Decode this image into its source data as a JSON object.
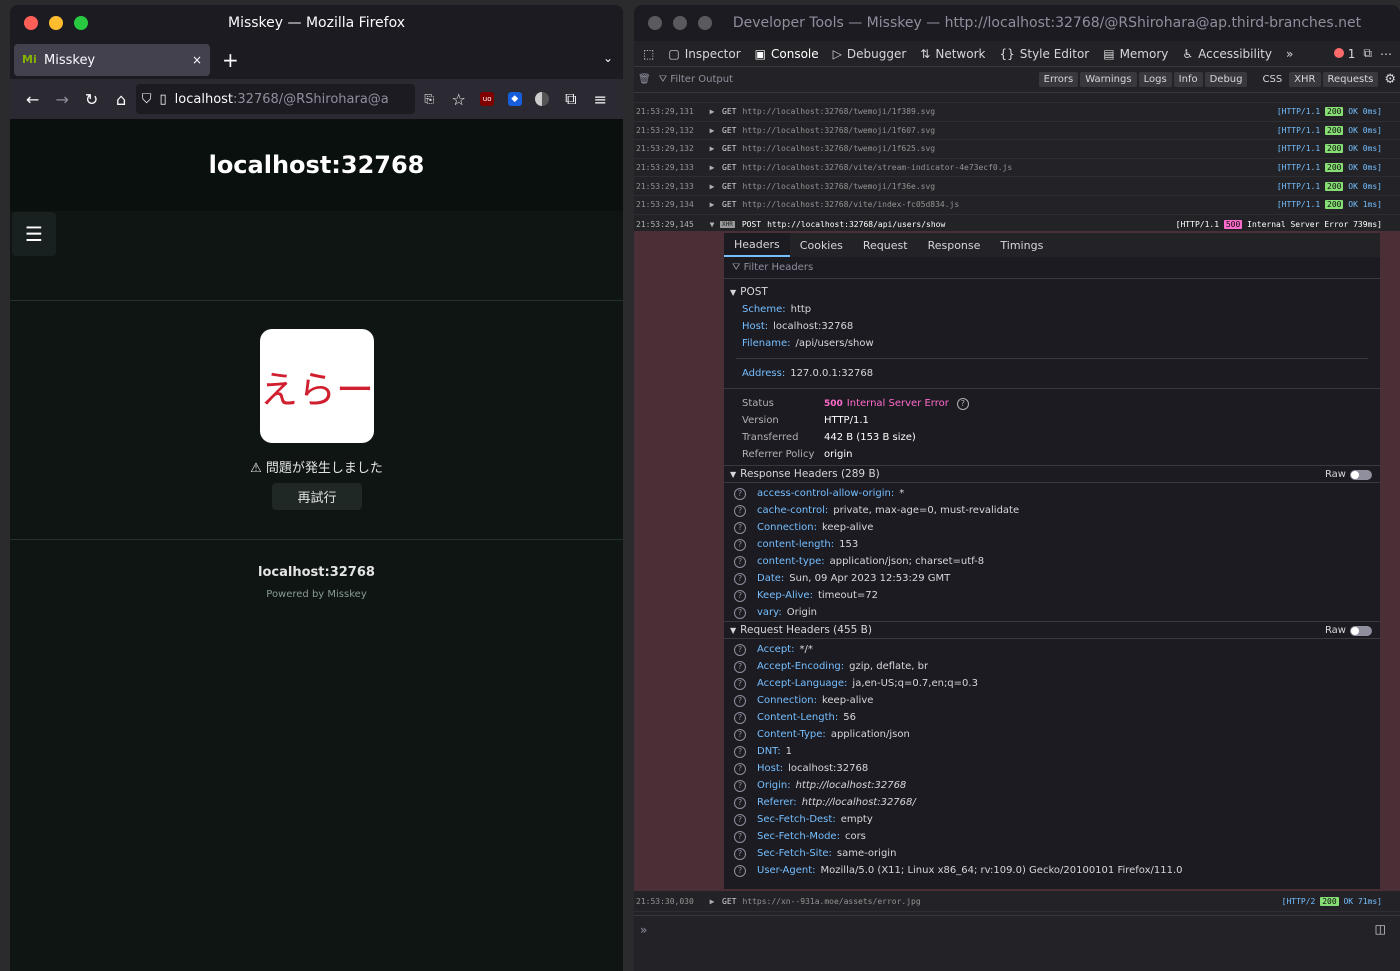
{
  "firefox": {
    "window_title": "Misskey — Mozilla Firefox",
    "tab_title": "Misskey",
    "favicon": "Mi",
    "close": "×",
    "new_tab": "+",
    "url_host": "localhost",
    "url_rest": ":32768/@RShirohara@a",
    "page": {
      "header_title": "localhost:32768",
      "error_image_text": "えらー",
      "error_message": "⚠ 問題が発生しました",
      "retry_label": "再試行",
      "footer_host": "localhost:32768",
      "footer_powered": "Powered by Misskey"
    }
  },
  "devtools": {
    "window_title": "Developer Tools — Misskey — http://localhost:32768/@RShirohara@ap.third-branches.net",
    "tabs": [
      "Inspector",
      "Console",
      "Debugger",
      "Network",
      "Style Editor",
      "Memory",
      "Accessibility"
    ],
    "error_count": "1",
    "filter_placeholder": "Filter Output",
    "filter_buttons": [
      "Errors",
      "Warnings",
      "Logs",
      "Info",
      "Debug",
      "CSS",
      "XHR",
      "Requests"
    ],
    "log_rows": [
      {
        "ts": "21:53:29,131",
        "method": "GET",
        "url": "http://localhost:32768/twemoji/1f389.svg",
        "proto": "[HTTP/1.1",
        "code": "200",
        "rest": "OK 0ms]"
      },
      {
        "ts": "21:53:29,132",
        "method": "GET",
        "url": "http://localhost:32768/twemoji/1f607.svg",
        "proto": "[HTTP/1.1",
        "code": "200",
        "rest": "OK 0ms]"
      },
      {
        "ts": "21:53:29,132",
        "method": "GET",
        "url": "http://localhost:32768/twemoji/1f625.svg",
        "proto": "[HTTP/1.1",
        "code": "200",
        "rest": "OK 0ms]"
      },
      {
        "ts": "21:53:29,133",
        "method": "GET",
        "url": "http://localhost:32768/vite/stream-indicator-4e73ecf0.js",
        "proto": "[HTTP/1.1",
        "code": "200",
        "rest": "OK 0ms]"
      },
      {
        "ts": "21:53:29,133",
        "method": "GET",
        "url": "http://localhost:32768/twemoji/1f36e.svg",
        "proto": "[HTTP/1.1",
        "code": "200",
        "rest": "OK 0ms]"
      },
      {
        "ts": "21:53:29,134",
        "method": "GET",
        "url": "http://localhost:32768/vite/index-fc05d834.js",
        "proto": "[HTTP/1.1",
        "code": "200",
        "rest": "OK 1ms]"
      }
    ],
    "error_row": {
      "ts": "21:53:29,145",
      "badge": "XHR",
      "method": "POST",
      "url": "http://localhost:32768/api/users/show",
      "proto": "[HTTP/1.1",
      "code": "500",
      "rest": "Internal Server Error 739ms]"
    },
    "net_tabs": [
      "Headers",
      "Cookies",
      "Request",
      "Response",
      "Timings"
    ],
    "filter_headers": "Filter Headers",
    "post_section": "POST",
    "post_info": [
      {
        "k": "Scheme:",
        "v": "http"
      },
      {
        "k": "Host:",
        "v": "localhost:32768"
      },
      {
        "k": "Filename:",
        "v": "/api/users/show"
      }
    ],
    "address": {
      "k": "Address:",
      "v": "127.0.0.1:32768"
    },
    "status": {
      "label": "Status",
      "code": "500",
      "text": "Internal Server Error"
    },
    "summary": [
      {
        "k": "Version",
        "v": "HTTP/1.1"
      },
      {
        "k": "Transferred",
        "v": "442 B (153 B size)"
      },
      {
        "k": "Referrer Policy",
        "v": "origin"
      }
    ],
    "response_headers_title": "Response Headers (289 B)",
    "raw_label": "Raw",
    "response_headers": [
      {
        "k": "access-control-allow-origin:",
        "v": "*"
      },
      {
        "k": "cache-control:",
        "v": "private, max-age=0, must-revalidate"
      },
      {
        "k": "Connection:",
        "v": "keep-alive"
      },
      {
        "k": "content-length:",
        "v": "153"
      },
      {
        "k": "content-type:",
        "v": "application/json; charset=utf-8"
      },
      {
        "k": "Date:",
        "v": "Sun, 09 Apr 2023 12:53:29 GMT"
      },
      {
        "k": "Keep-Alive:",
        "v": "timeout=72"
      },
      {
        "k": "vary:",
        "v": "Origin"
      }
    ],
    "request_headers_title": "Request Headers (455 B)",
    "request_headers": [
      {
        "k": "Accept:",
        "v": "*/*"
      },
      {
        "k": "Accept-Encoding:",
        "v": "gzip, deflate, br"
      },
      {
        "k": "Accept-Language:",
        "v": "ja,en-US;q=0.7,en;q=0.3"
      },
      {
        "k": "Connection:",
        "v": "keep-alive"
      },
      {
        "k": "Content-Length:",
        "v": "56"
      },
      {
        "k": "Content-Type:",
        "v": "application/json"
      },
      {
        "k": "DNT:",
        "v": "1"
      },
      {
        "k": "Host:",
        "v": "localhost:32768"
      },
      {
        "k": "Origin:",
        "v": "http://localhost:32768"
      },
      {
        "k": "Referer:",
        "v": "http://localhost:32768/"
      },
      {
        "k": "Sec-Fetch-Dest:",
        "v": "empty"
      },
      {
        "k": "Sec-Fetch-Mode:",
        "v": "cors"
      },
      {
        "k": "Sec-Fetch-Site:",
        "v": "same-origin"
      },
      {
        "k": "User-Agent:",
        "v": "Mozilla/5.0 (X11; Linux x86_64; rv:109.0) Gecko/20100101 Firefox/111.0"
      }
    ],
    "last_row": {
      "ts": "21:53:30,030",
      "method": "GET",
      "url": "https://xn--931a.moe/assets/error.jpg",
      "proto": "[HTTP/2",
      "code": "200",
      "rest": "OK 71ms]"
    },
    "prompt": "»"
  },
  "colors": {
    "close": "#ff5f57",
    "minimize": "#febc2e",
    "maximize": "#28c840",
    "accent": "#75bfff",
    "error": "#ff6bcb",
    "ok": "#86de74"
  }
}
